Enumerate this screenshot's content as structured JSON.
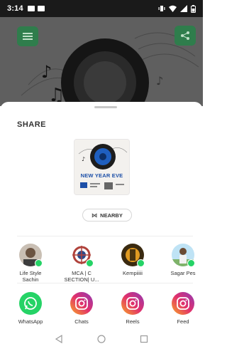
{
  "status_bar": {
    "time": "3:14"
  },
  "sheet": {
    "title": "SHARE",
    "preview": {
      "poster_title": "NEW YEAR EVE"
    },
    "nearby_label": "NEARBY"
  },
  "contacts": [
    {
      "name": "Life Style\nSachin",
      "avatar_color": "#7a6a5a",
      "badge": "whatsapp"
    },
    {
      "name": "MCA | C\nSECTION| U...",
      "avatar_color": "#b0433c",
      "badge": "whatsapp"
    },
    {
      "name": "Kempiiiii",
      "avatar_color": "#d48c1a",
      "badge": "whatsapp"
    },
    {
      "name": "Sagar Pes",
      "avatar_color": "#8fa3b8",
      "badge": "whatsapp"
    }
  ],
  "apps": [
    {
      "name": "WhatsApp",
      "icon": "whatsapp-icon",
      "color": "#25d366"
    },
    {
      "name": "Chats",
      "icon": "instagram-icon",
      "color": "#e1306c"
    },
    {
      "name": "Reels",
      "icon": "instagram-icon",
      "color": "#e1306c"
    },
    {
      "name": "Feed",
      "icon": "instagram-icon",
      "color": "#e1306c"
    }
  ],
  "nav_bar": {
    "back_icon": "back-triangle-icon",
    "home_icon": "home-circle-icon",
    "recents_icon": "recents-square-icon"
  }
}
